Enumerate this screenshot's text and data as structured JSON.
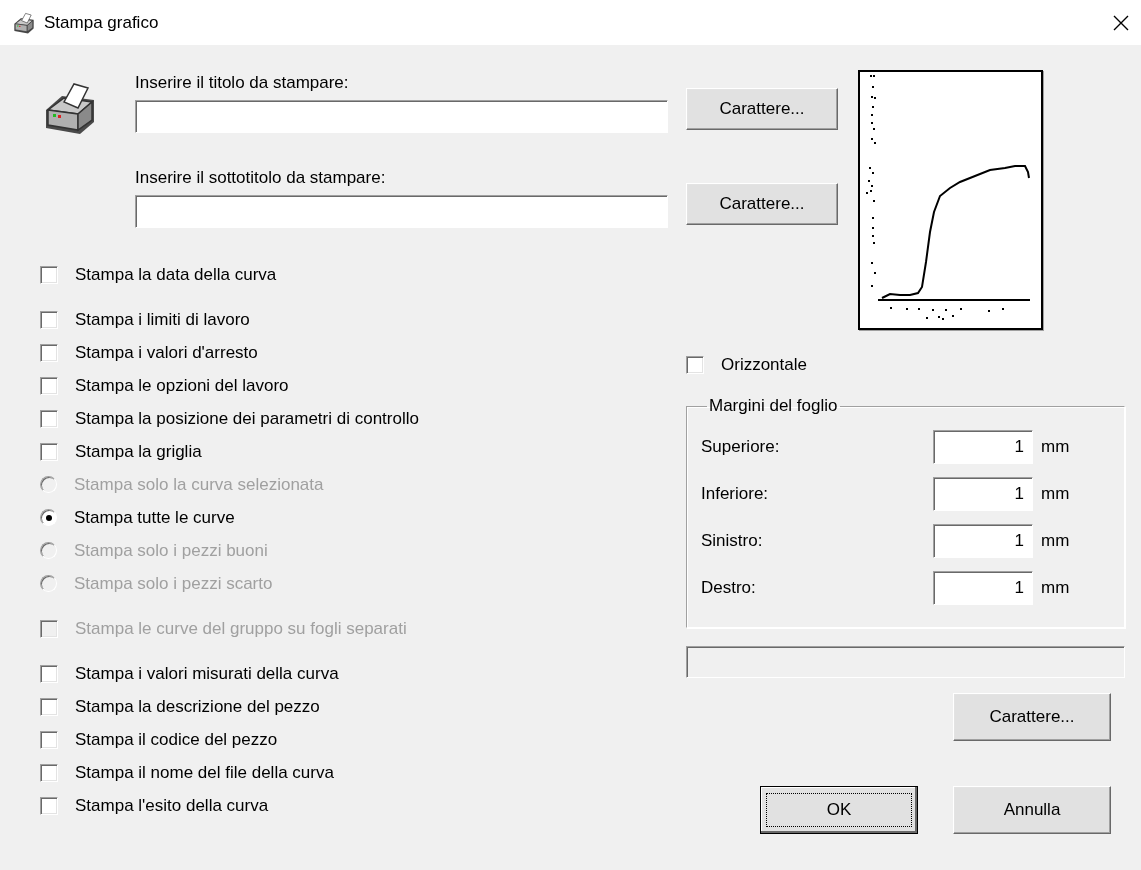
{
  "window": {
    "title": "Stampa grafico"
  },
  "title_field": {
    "label": "Inserire il titolo da stampare:",
    "button": "Carattere..."
  },
  "subtitle_field": {
    "label": "Inserire il sottotitolo da stampare:",
    "button": "Carattere..."
  },
  "option_groups": [
    [
      {
        "kind": "checkbox",
        "label": "Stampa la data della curva",
        "checked": false,
        "disabled": false
      }
    ],
    [
      {
        "kind": "checkbox",
        "label": "Stampa i limiti di lavoro",
        "checked": false,
        "disabled": false
      },
      {
        "kind": "checkbox",
        "label": "Stampa i valori d'arresto",
        "checked": false,
        "disabled": false
      },
      {
        "kind": "checkbox",
        "label": "Stampa le opzioni del lavoro",
        "checked": false,
        "disabled": false
      },
      {
        "kind": "checkbox",
        "label": "Stampa la posizione dei parametri di controllo",
        "checked": false,
        "disabled": false
      },
      {
        "kind": "checkbox",
        "label": "Stampa la griglia",
        "checked": false,
        "disabled": false
      },
      {
        "kind": "radio",
        "label": "Stampa solo la curva selezionata",
        "selected": false,
        "disabled": true
      },
      {
        "kind": "radio",
        "label": "Stampa tutte le curve",
        "selected": true,
        "disabled": false
      },
      {
        "kind": "radio",
        "label": "Stampa solo i pezzi buoni",
        "selected": false,
        "disabled": true
      },
      {
        "kind": "radio",
        "label": "Stampa solo i pezzi scarto",
        "selected": false,
        "disabled": true
      }
    ],
    [
      {
        "kind": "checkbox",
        "label": "Stampa le curve del gruppo su fogli separati",
        "checked": false,
        "disabled": true
      }
    ],
    [
      {
        "kind": "checkbox",
        "label": "Stampa i valori misurati della curva",
        "checked": false,
        "disabled": false
      },
      {
        "kind": "checkbox",
        "label": "Stampa la descrizione del pezzo",
        "checked": false,
        "disabled": false
      },
      {
        "kind": "checkbox",
        "label": "Stampa il codice del pezzo",
        "checked": false,
        "disabled": false
      },
      {
        "kind": "checkbox",
        "label": "Stampa il nome del file della curva",
        "checked": false,
        "disabled": false
      },
      {
        "kind": "checkbox",
        "label": "Stampa l'esito della curva",
        "checked": false,
        "disabled": false
      }
    ]
  ],
  "orientation": {
    "label": "Orizzontale",
    "checked": false
  },
  "margins": {
    "title": "Margini del foglio",
    "rows": [
      {
        "label": "Superiore:",
        "value": "1",
        "unit": "mm"
      },
      {
        "label": "Inferiore:",
        "value": "1",
        "unit": "mm"
      },
      {
        "label": "Sinistro:",
        "value": "1",
        "unit": "mm"
      },
      {
        "label": "Destro:",
        "value": "1",
        "unit": "mm"
      }
    ]
  },
  "progress": {
    "level": 0
  },
  "font_button": "Carattere...",
  "buttons": [
    {
      "label": "OK",
      "default": true
    },
    {
      "label": "Annulla",
      "default": false
    }
  ]
}
